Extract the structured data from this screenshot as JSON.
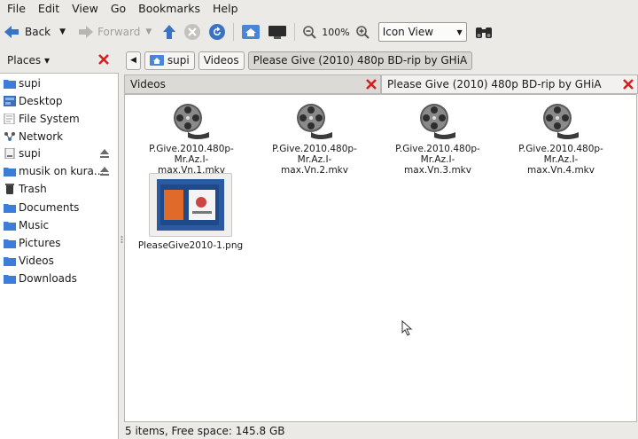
{
  "menu": [
    "File",
    "Edit",
    "View",
    "Go",
    "Bookmarks",
    "Help"
  ],
  "toolbar": {
    "back_label": "Back",
    "forward_label": "Forward",
    "zoom": "100%",
    "view_mode": "Icon View"
  },
  "places": {
    "title": "Places ▾",
    "items": [
      {
        "label": "supi",
        "icon": "folder-icon"
      },
      {
        "label": "Desktop",
        "icon": "desktop-icon"
      },
      {
        "label": "File System",
        "icon": "filesystem-icon"
      },
      {
        "label": "Network",
        "icon": "network-icon"
      },
      {
        "label": "supi",
        "icon": "drive-icon"
      },
      {
        "label": "musik on kura...",
        "icon": "folder-icon"
      },
      {
        "label": "Trash",
        "icon": "trash-icon"
      },
      {
        "label": "Documents",
        "icon": "folder-icon"
      },
      {
        "label": "Music",
        "icon": "folder-icon"
      },
      {
        "label": "Pictures",
        "icon": "folder-icon"
      },
      {
        "label": "Videos",
        "icon": "folder-icon"
      },
      {
        "label": "Downloads",
        "icon": "folder-icon"
      }
    ]
  },
  "path": [
    "supi",
    "Videos",
    "Please Give (2010) 480p BD-rip by GHiA"
  ],
  "tabs": [
    "Videos",
    "Please Give (2010) 480p BD-rip by GHiA"
  ],
  "files": [
    {
      "line1": "P.Give.2010.480p-Mr.Az.I-",
      "line2": "max.Vn.1.mkv",
      "icon": "video-reel-icon"
    },
    {
      "line1": "P.Give.2010.480p-Mr.Az.I-",
      "line2": "max.Vn.2.mkv",
      "icon": "video-reel-icon"
    },
    {
      "line1": "P.Give.2010.480p-Mr.Az.I-",
      "line2": "max.Vn.3.mkv",
      "icon": "video-reel-icon"
    },
    {
      "line1": "P.Give.2010.480p-Mr.Az.I-",
      "line2": "max.Vn.4.mkv",
      "icon": "video-reel-icon"
    },
    {
      "line1": "PleaseGive2010-1.png",
      "line2": "",
      "icon": "image-thumbnail"
    }
  ],
  "status": "5 items, Free space: 145.8 GB",
  "colors": {
    "accent": "#2f6fc2",
    "close": "#d62020",
    "folder": "#3b7dd8"
  }
}
